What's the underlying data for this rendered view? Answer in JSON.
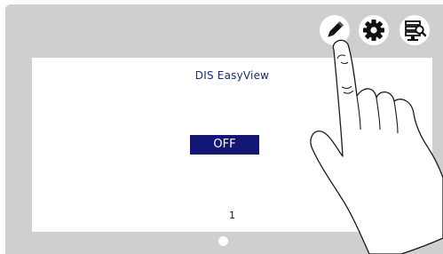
{
  "screen": {
    "title": "DIS EasyView",
    "toggle_label": "OFF",
    "page_number": "1"
  },
  "toolbar": {
    "icons": [
      "pencil-icon",
      "gear-icon",
      "monitor-search-icon"
    ]
  },
  "colors": {
    "toggle_background": "#131675",
    "title_text": "#1d2a6b",
    "device_bezel": "#cfcfcf"
  }
}
